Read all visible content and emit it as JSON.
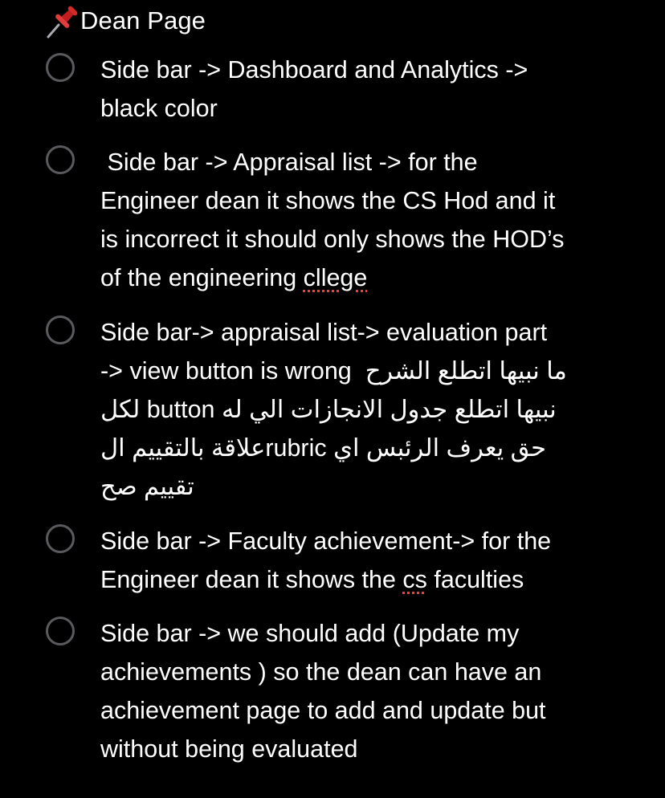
{
  "note": {
    "title": "Dean Page",
    "title_icon": "pushpin-icon",
    "colors": {
      "background": "#000000",
      "text": "#ffffff",
      "checkbox_border": "#5a5a5e",
      "pin_red": "#d42a2a",
      "spellcheck": "#ff3b30"
    },
    "items": [
      {
        "checked": false,
        "lines": [
          "Side bar -> Dashboard and Analytics ->",
          "black color"
        ]
      },
      {
        "checked": false,
        "lines": [
          " Side bar -> Appraisal list -> for the",
          "Engineer dean it shows the CS Hod and it",
          "is incorrect it should only shows the HOD’s",
          "of the engineering "
        ],
        "misspelled": "cllege"
      },
      {
        "checked": false,
        "lines": [
          "Side bar-> appraisal list-> evaluation part",
          "-> view button is wrong  ما نبيها اتطلع الشرح",
          "نبيها اتطلع جدول الانجازات الي له button لكل",
          "حق يعرف الرئبس اي rubricعلاقة بالتقييم ال",
          "تقييم صح"
        ]
      },
      {
        "checked": false,
        "lines": [
          "Side bar -> Faculty achievement-> for the",
          "Engineer dean it shows the "
        ],
        "misspelled": "cs",
        "after_misspelled": " faculties"
      },
      {
        "checked": false,
        "lines": [
          "Side bar -> we should add (Update my",
          "achievements ) so the dean can have an",
          "achievement page to add and update but",
          "without being evaluated"
        ]
      }
    ]
  }
}
